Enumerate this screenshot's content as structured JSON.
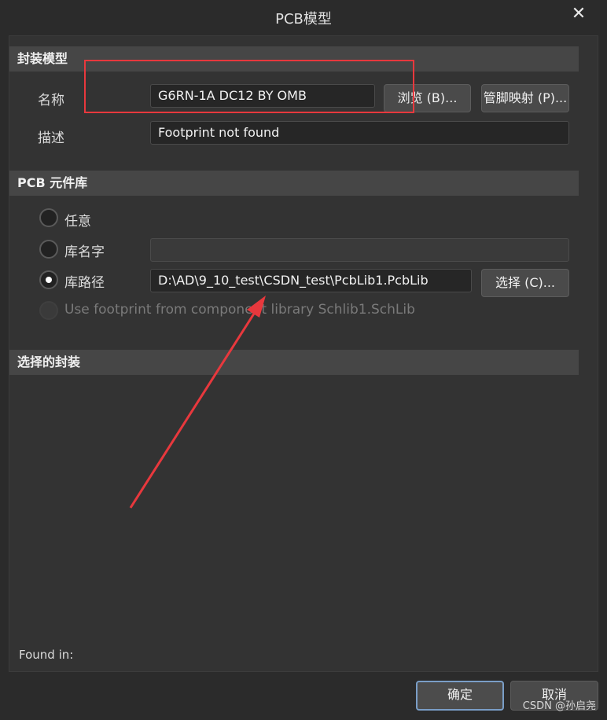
{
  "window": {
    "title": "PCB模型",
    "close_glyph": "✕"
  },
  "footprint_model": {
    "header": "封装模型",
    "name_label": "名称",
    "name_value": "G6RN-1A DC12 BY OMB",
    "browse_button": "浏览 (B)...",
    "pin_map_button": "管脚映射 (P)...",
    "desc_label": "描述",
    "desc_value": "Footprint not found"
  },
  "pcb_library": {
    "header": "PCB 元件库",
    "options": [
      {
        "label": "任意",
        "checked": false,
        "disabled": false
      },
      {
        "label": "库名字",
        "checked": false,
        "disabled": false
      },
      {
        "label": "库路径",
        "checked": true,
        "disabled": false
      },
      {
        "label": "Use footprint from component library Schlib1.SchLib",
        "checked": false,
        "disabled": true
      }
    ],
    "lib_name_value": "",
    "lib_path_value": "D:\\AD\\9_10_test\\CSDN_test\\PcbLib1.PcbLib",
    "choose_button": "选择 (C)..."
  },
  "selected_footprint": {
    "header": "选择的封装"
  },
  "found_in": "Found in:",
  "footer": {
    "ok_button": "确定",
    "cancel_button": "取消"
  },
  "watermark": "CSDN @孙启尧",
  "annotation": {
    "color": "#e8383d"
  }
}
